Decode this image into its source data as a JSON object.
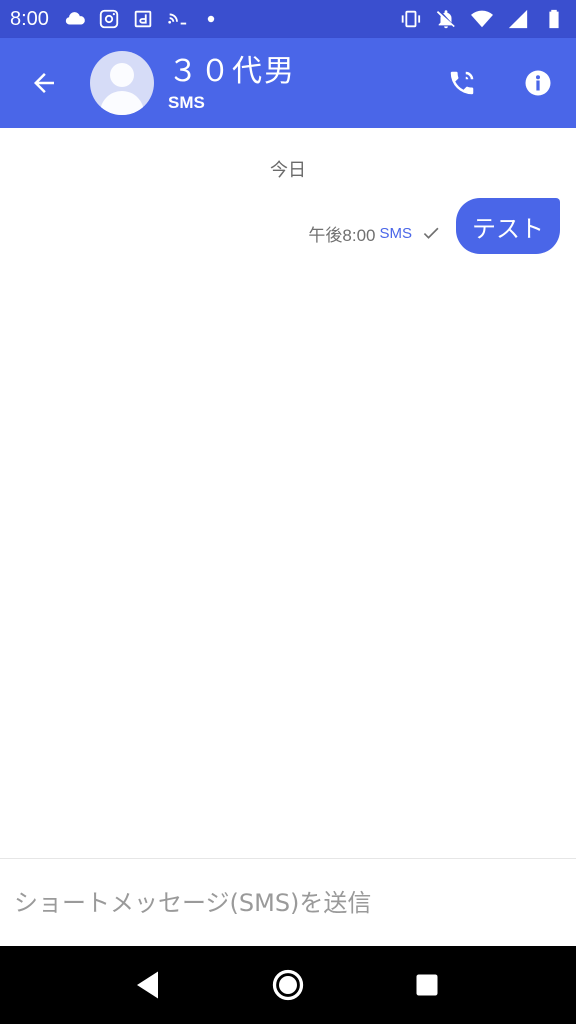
{
  "status_bar": {
    "time": "8:00",
    "left_icons": [
      "cloud-icon",
      "instagram-icon",
      "docomo-icon",
      "nfc-on-icon",
      "dot-icon"
    ],
    "right_icons": [
      "vibrate-icon",
      "mute-bell-icon",
      "wifi-icon",
      "signal-icon",
      "battery-icon"
    ]
  },
  "header": {
    "contact_name": "３０代男",
    "subtitle": "SMS",
    "actions": [
      "call-icon",
      "info-icon"
    ]
  },
  "conversation": {
    "date_divider": "今日",
    "messages": [
      {
        "text": "テスト",
        "time": "午後8:00",
        "type": "SMS",
        "status": "sent"
      }
    ]
  },
  "composer": {
    "placeholder": "ショートメッセージ(SMS)を送信"
  },
  "colors": {
    "status_bar": "#3a4fcf",
    "app_bar": "#4a66e8",
    "bubble": "#4a66e8"
  }
}
